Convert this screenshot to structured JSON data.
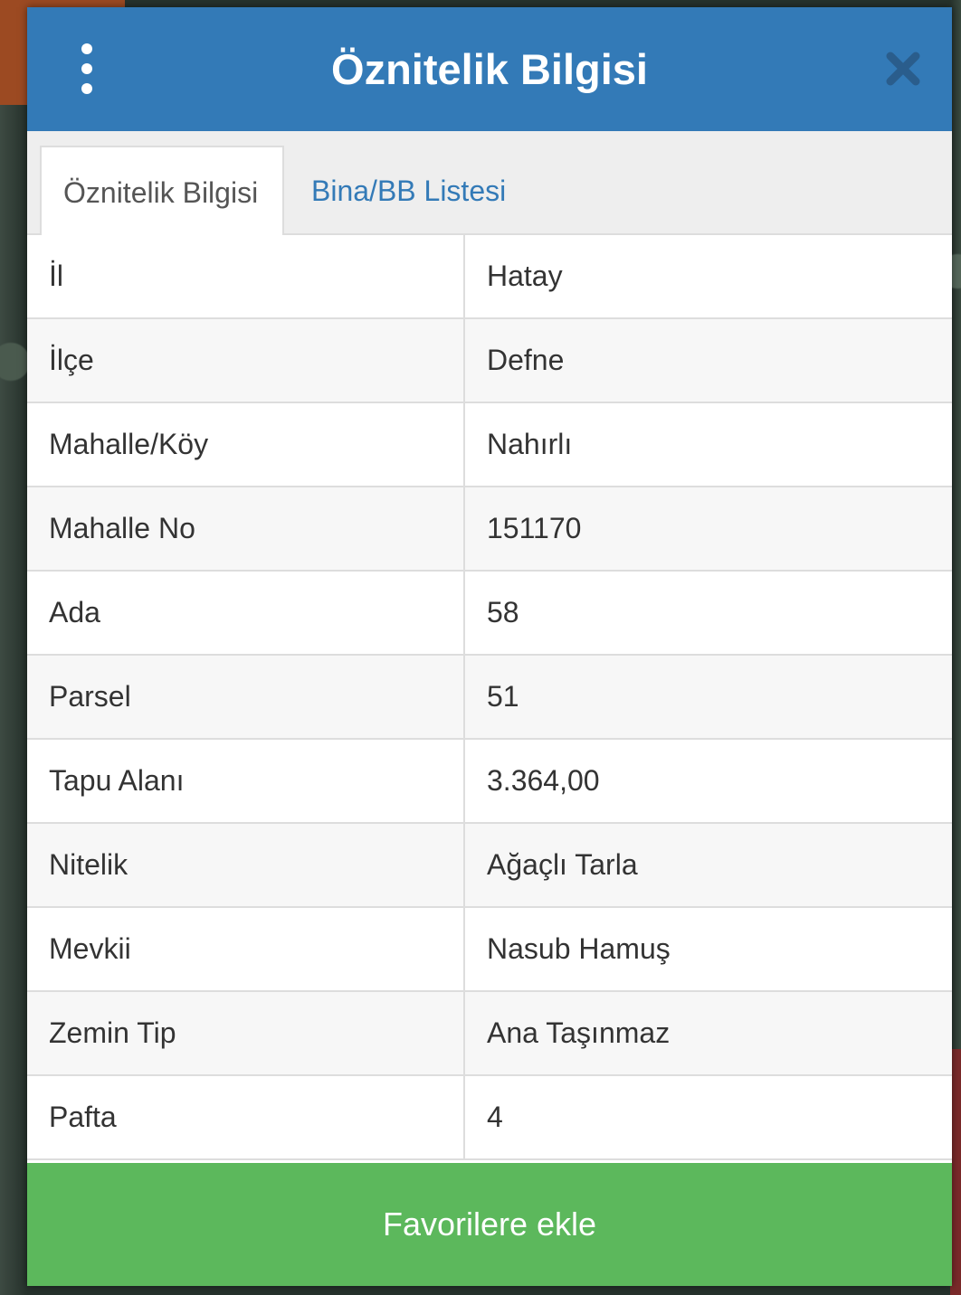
{
  "header": {
    "title": "Öznitelik Bilgisi",
    "menu_icon": "vertical-ellipsis-icon",
    "close_icon": "close-icon"
  },
  "tabs": [
    {
      "label": "Öznitelik Bilgisi",
      "active": true
    },
    {
      "label": "Bina/BB Listesi",
      "active": false
    }
  ],
  "attributes": [
    {
      "key": "İl",
      "value": "Hatay"
    },
    {
      "key": "İlçe",
      "value": "Defne"
    },
    {
      "key": "Mahalle/Köy",
      "value": "Nahırlı"
    },
    {
      "key": "Mahalle No",
      "value": "151170"
    },
    {
      "key": "Ada",
      "value": "58"
    },
    {
      "key": "Parsel",
      "value": "51"
    },
    {
      "key": "Tapu Alanı",
      "value": "3.364,00"
    },
    {
      "key": "Nitelik",
      "value": "Ağaçlı Tarla"
    },
    {
      "key": "Mevkii",
      "value": "Nasub Hamuş"
    },
    {
      "key": "Zemin Tip",
      "value": "Ana Taşınmaz"
    },
    {
      "key": "Pafta",
      "value": "4"
    }
  ],
  "footer": {
    "favorite_label": "Favorilere ekle"
  },
  "colors": {
    "header": "#337ab7",
    "favorite_button": "#5cb85c",
    "tab_link": "#337ab7"
  }
}
